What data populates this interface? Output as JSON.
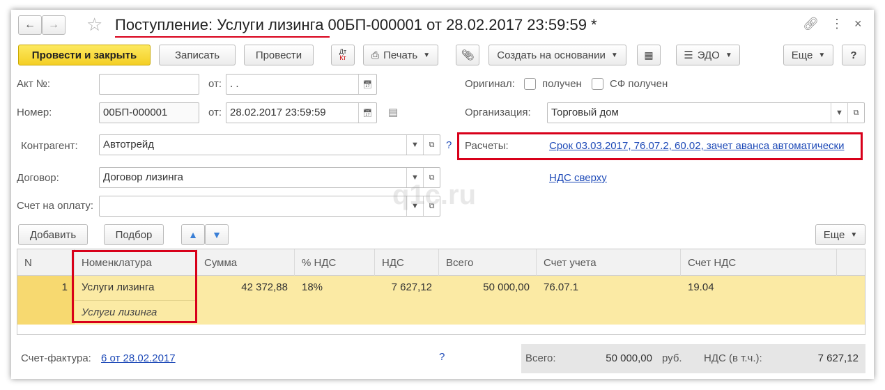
{
  "window": {
    "title": "Поступление: Услуги лизинга 00БП-000001 от 28.02.2017 23:59:59 *"
  },
  "toolbar": {
    "post_close": "Провести и закрыть",
    "save": "Записать",
    "post": "Провести",
    "dtkt": "Дт Кт",
    "print": "Печать",
    "create_based": "Создать на основании",
    "edo": "ЭДО",
    "more": "Еще",
    "help": "?"
  },
  "form": {
    "act_label": "Акт №:",
    "act_value": "",
    "from_label": "от:",
    "act_date": " .  .",
    "number_label": "Номер:",
    "number_value": "00БП-000001",
    "number_date": "28.02.2017 23:59:59",
    "original_label": "Оригинал:",
    "received_label": "получен",
    "sf_received_label": "СФ получен",
    "org_label": "Организация:",
    "org_value": "Торговый дом",
    "counterparty_label": "Контрагент:",
    "counterparty_value": "Автотрейд",
    "help_q": "?",
    "settlements_label": "Расчеты:",
    "settlements_link": "Срок 03.03.2017, 76.07.2, 60.02, зачет аванса автоматически",
    "contract_label": "Договор:",
    "contract_value": "Договор лизинга",
    "vat_link": "НДС сверху",
    "invoice_label": "Счет на оплату:",
    "invoice_value": "",
    "watermark": "q1c.ru"
  },
  "table_toolbar": {
    "add": "Добавить",
    "pick": "Подбор",
    "more": "Еще"
  },
  "table": {
    "headers": [
      "N",
      "Номенклатура",
      "Сумма",
      "% НДС",
      "НДС",
      "Всего",
      "Счет учета",
      "Счет НДС"
    ],
    "rows": [
      {
        "n": "1",
        "nomenclature": "Услуги лизинга",
        "content": "Услуги лизинга",
        "sum": "42 372,88",
        "vat_rate": "18%",
        "vat": "7 627,12",
        "total": "50 000,00",
        "account": "76.07.1",
        "vat_account": "19.04"
      }
    ]
  },
  "footer": {
    "invoice_label": "Счет-фактура:",
    "invoice_link": "6 от 28.02.2017",
    "help_q": "?",
    "total_label": "Всего:",
    "total_value": "50 000,00",
    "currency": "руб.",
    "vat_label": "НДС (в т.ч.):",
    "vat_value": "7 627,12"
  },
  "colors": {
    "accent_yellow": "#f4cf25",
    "selected_row": "#fbeaa4",
    "link": "#1f4bb8",
    "highlight_red": "#d8001a"
  }
}
